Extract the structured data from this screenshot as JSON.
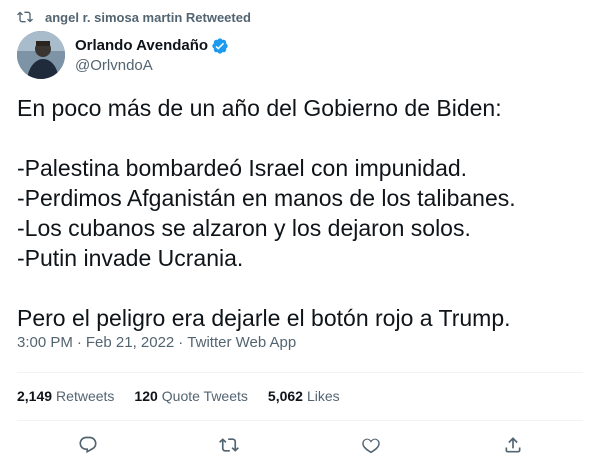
{
  "retweet_context": {
    "text": "angel r.  simosa martin Retweeted"
  },
  "author": {
    "display_name": "Orlando Avendaño",
    "handle": "@OrlvndoA",
    "verified": true
  },
  "tweet": {
    "lines": [
      "En poco más de un año del Gobierno de Biden:",
      "",
      "-Palestina bombardeó Israel con impunidad.",
      "-Perdimos Afganistán en manos de los talibanes.",
      "-Los cubanos se alzaron y los dejaron solos.",
      "-Putin invade Ucrania.",
      "",
      "Pero el peligro era dejarle el botón rojo a Trump."
    ]
  },
  "meta": {
    "time": "3:00 PM",
    "date": "Feb 21, 2022",
    "separator": "·",
    "source": "Twitter Web App"
  },
  "stats": {
    "retweets": {
      "count": "2,149",
      "label": "Retweets"
    },
    "quote_tweets": {
      "count": "120",
      "label": "Quote Tweets"
    },
    "likes": {
      "count": "5,062",
      "label": "Likes"
    }
  },
  "actions": [
    "reply-icon",
    "retweet-icon",
    "like-icon",
    "share-icon"
  ],
  "colors": {
    "text": "#0f1419",
    "secondary": "#536471",
    "divider": "#eff3f4",
    "verified": "#1d9bf0"
  }
}
